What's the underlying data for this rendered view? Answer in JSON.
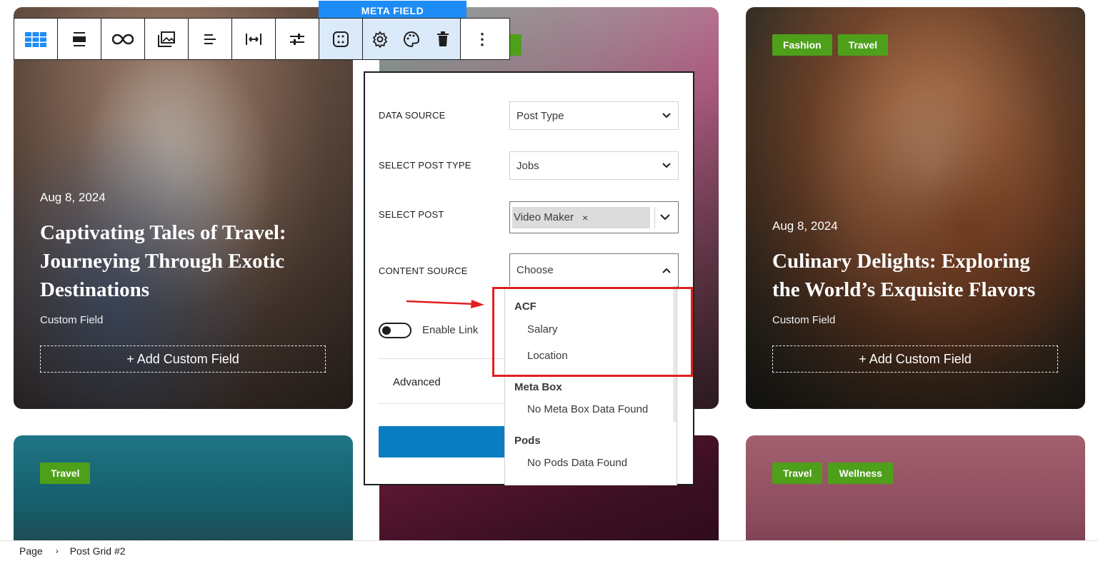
{
  "toolbar": {
    "meta_field_label": "META FIELD",
    "buttons": [
      "grid-view-icon",
      "align-wide-icon",
      "link-icon",
      "gallery-icon",
      "align-left-icon",
      "width-icon",
      "controls-icon",
      "meta-field-icon",
      "settings-icon",
      "styles-icon",
      "delete-icon",
      "more-options-icon"
    ],
    "more_label": "⋮"
  },
  "cards": [
    {
      "tags": [],
      "date": "Aug 8, 2024",
      "title": "Captivating Tales of Travel: Journeying Through Exotic Destinations",
      "custom_field": "Custom Field",
      "add_field": "+ Add Custom Field"
    },
    {
      "tags": [
        "Fashion",
        "Travel"
      ],
      "date": "Aug 8, 2024",
      "title": "Culinary Delights: Exploring the World’s Exquisite Flavors",
      "custom_field": "Custom Field",
      "add_field": "+ Add Custom Field"
    },
    {
      "tags": [
        "Travel"
      ]
    },
    {
      "tags": [
        "Travel",
        "Wellness"
      ]
    }
  ],
  "panel": {
    "data_source_label": "DATA SOURCE",
    "data_source_value": "Post Type",
    "post_type_label": "SELECT POST TYPE",
    "post_type_value": "Jobs",
    "post_label": "SELECT POST",
    "post_token": "Video Maker",
    "post_token_remove": "×",
    "content_source_label": "CONTENT SOURCE",
    "content_source_placeholder": "Choose",
    "enable_link_label": "Enable Link",
    "enable_link_on": false,
    "advanced_label": "Advanced"
  },
  "dropdown": {
    "groups": [
      {
        "label": "ACF",
        "options": [
          "Salary",
          "Location"
        ]
      },
      {
        "label": "Meta Box",
        "options": [
          "No Meta Box Data Found"
        ]
      },
      {
        "label": "Pods",
        "options": [
          "No Pods Data Found"
        ]
      }
    ]
  },
  "breadcrumb": {
    "items": [
      "Page",
      "Post Grid #2"
    ],
    "separator": "›"
  },
  "colors": {
    "tag_green": "#4e9f1a",
    "toolbar_active": "#dbeaf9",
    "meta_label_blue": "#1e8cf5",
    "highlight_red": "#e02020",
    "primary_button": "#0a7dc2"
  }
}
